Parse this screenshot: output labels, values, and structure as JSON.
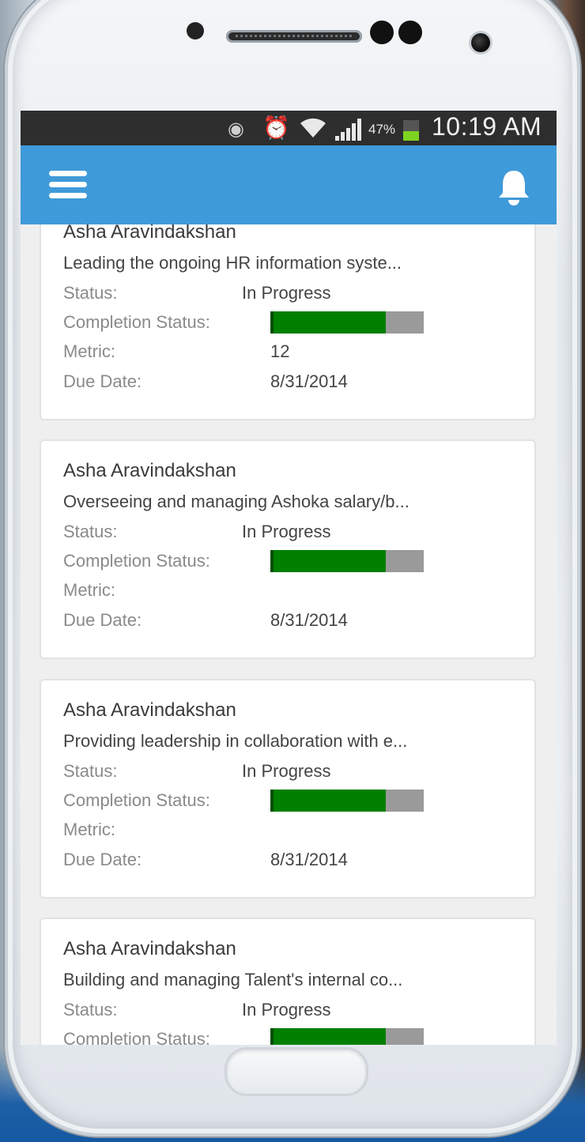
{
  "status_bar": {
    "battery_percent": "47%",
    "battery_level": 0.47,
    "time": "10:19 AM",
    "icons": [
      "eye-icon",
      "alarm-icon",
      "wifi-icon",
      "signal-icon",
      "battery-icon"
    ]
  },
  "app_bar": {
    "background_color": "#3f9ad9",
    "icons": [
      "hamburger-menu-icon",
      "bell-icon"
    ]
  },
  "labels": {
    "status": "Status:",
    "completion_status": "Completion Status:",
    "metric": "Metric:",
    "due_date": "Due Date:"
  },
  "cards": [
    {
      "name": "Asha Aravindakshan",
      "description": "Leading the ongoing HR information syste...",
      "status": "In Progress",
      "completion": 0.75,
      "metric": "12",
      "due_date": "8/31/2014"
    },
    {
      "name": "Asha Aravindakshan",
      "description": "Overseeing and managing Ashoka salary/b...",
      "status": "In Progress",
      "completion": 0.75,
      "metric": "",
      "due_date": "8/31/2014"
    },
    {
      "name": "Asha Aravindakshan",
      "description": "Providing leadership in collaboration with e...",
      "status": "In Progress",
      "completion": 0.75,
      "metric": "",
      "due_date": "8/31/2014"
    },
    {
      "name": "Asha Aravindakshan",
      "description": "Building and managing Talent's internal co...",
      "status": "In Progress",
      "completion": 0.75,
      "metric": "",
      "due_date": ""
    }
  ],
  "progress_colors": {
    "fill": "#007f00",
    "track": "#9a9a9a"
  }
}
